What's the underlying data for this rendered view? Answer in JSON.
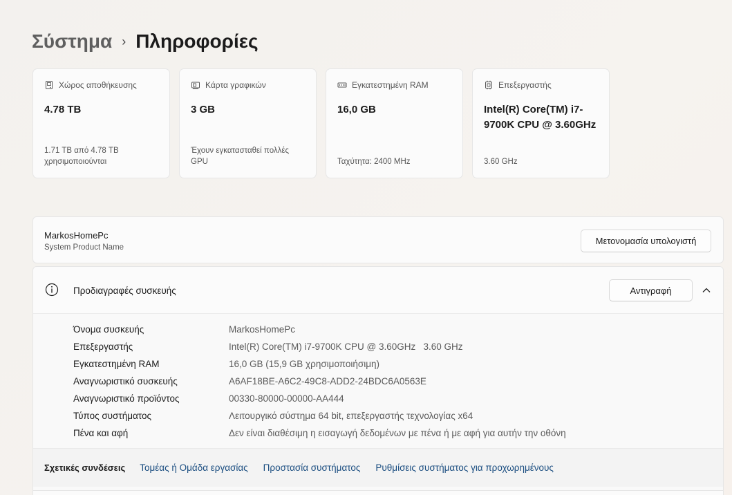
{
  "breadcrumb": {
    "parent": "Σύστημα",
    "separator": "›",
    "current": "Πληροφορίες"
  },
  "cards": [
    {
      "icon": "storage-icon",
      "title": "Χώρος αποθήκευσης",
      "value": "4.78 TB",
      "sub": "1.71 TB από 4.78 TB χρησιμοποιούνται"
    },
    {
      "icon": "graphics-card-icon",
      "title": "Κάρτα γραφικών",
      "value": "3 GB",
      "sub": "Έχουν εγκατασταθεί πολλές GPU"
    },
    {
      "icon": "ram-icon",
      "title": "Εγκατεστημένη RAM",
      "value": "16,0 GB",
      "sub": "Ταχύτητα: 2400 MHz"
    },
    {
      "icon": "processor-icon",
      "title": "Επεξεργαστής",
      "value": "Intel(R) Core(TM) i7-9700K CPU @ 3.60GHz",
      "sub": "3.60 GHz"
    }
  ],
  "device_name_panel": {
    "name": "MarkosHomePc",
    "sub": "System Product Name",
    "rename_label": "Μετονομασία υπολογιστή"
  },
  "specs": {
    "title": "Προδιαγραφές συσκευής",
    "copy_label": "Αντιγραφή",
    "rows": [
      {
        "label": "Όνομα συσκευής",
        "value": "MarkosHomePc"
      },
      {
        "label": "Επεξεργαστής",
        "value": "Intel(R) Core(TM) i7-9700K CPU @ 3.60GHz   3.60 GHz"
      },
      {
        "label": "Εγκατεστημένη RAM",
        "value": "16,0 GB (15,9 GB χρησιμοποιήσιμη)"
      },
      {
        "label": "Αναγνωριστικό συσκευής",
        "value": "A6AF18BE-A6C2-49C8-ADD2-24BDC6A0563E"
      },
      {
        "label": "Αναγνωριστικό προϊόντος",
        "value": "00330-80000-00000-AA444"
      },
      {
        "label": "Τύπος συστήματος",
        "value": "Λειτουργικό σύστημα 64 bit, επεξεργαστής τεχνολογίας x64"
      },
      {
        "label": "Πένα και αφή",
        "value": "Δεν είναι διαθέσιμη η εισαγωγή δεδομένων με πένα ή με αφή για αυτήν την οθόνη"
      }
    ]
  },
  "related": {
    "label": "Σχετικές συνδέσεις",
    "links": [
      "Τομέας ή Ομάδα εργασίας",
      "Προστασία συστήματος",
      "Ρυθμίσεις συστήματος για προχωρημένους"
    ]
  },
  "colors": {
    "link": "#1a4d80",
    "text": "#1b1b1b",
    "muted": "#5a5a5a"
  }
}
